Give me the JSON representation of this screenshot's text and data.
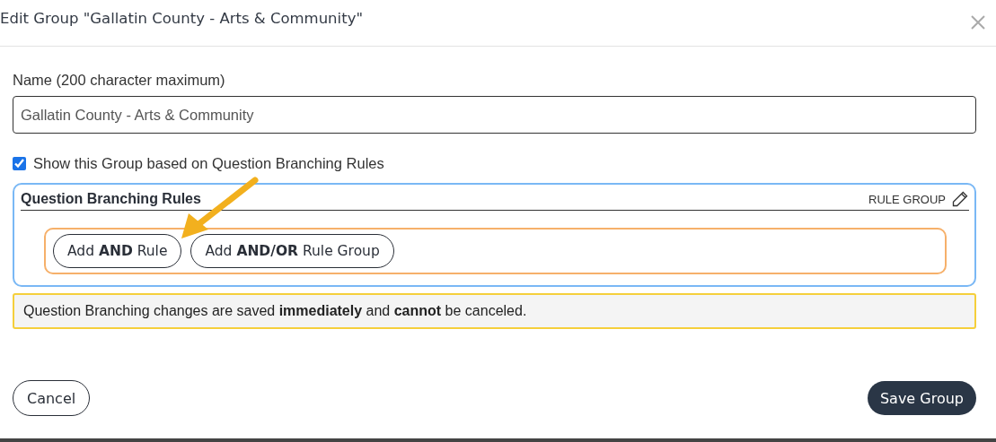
{
  "dialog": {
    "title": "Edit Group \"Gallatin County - Arts & Community\""
  },
  "name_field": {
    "label": "Name (200 character maximum)",
    "value": "Gallatin County - Arts & Community"
  },
  "branching_checkbox": {
    "label": "Show this Group based on Question Branching Rules",
    "checked": true
  },
  "rules_panel": {
    "title": "Question Branching Rules",
    "rule_group_label": "RULE GROUP",
    "buttons": [
      {
        "label": "Add **AND** Rule"
      },
      {
        "label": "Add **AND/OR** Rule Group"
      }
    ]
  },
  "notice": "Question Branching changes are saved **immediately** and **cannot** be canceled.",
  "footer": {
    "cancel": "Cancel",
    "save": "Save Group"
  }
}
